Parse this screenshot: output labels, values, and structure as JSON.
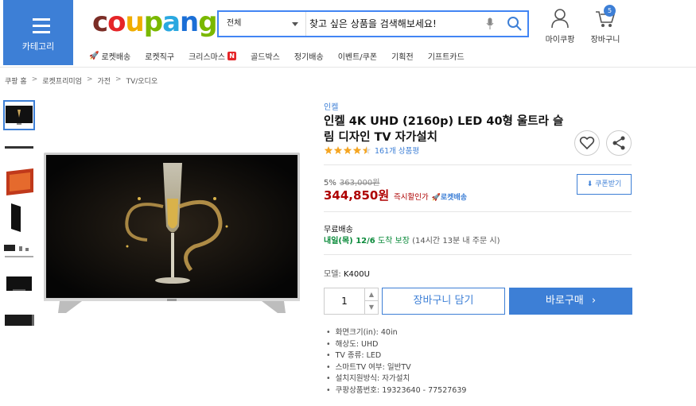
{
  "header": {
    "category_label": "카테고리",
    "logo": {
      "letters": [
        "c",
        "o",
        "u",
        "p",
        "a",
        "n",
        "g"
      ],
      "colors": [
        "#7b2d26",
        "#e52528",
        "#f0ad00",
        "#7ab800",
        "#2aa8e0",
        "#1b6fd6",
        "#7ab800"
      ]
    },
    "search": {
      "scope": "전체",
      "placeholder": "찾고 싶은 상품을 검색해보세요!"
    },
    "mycoupang_label": "마이쿠팡",
    "cart_label": "장바구니",
    "cart_count": "5"
  },
  "nav": {
    "items": [
      {
        "label": "로켓배송"
      },
      {
        "label": "로켓직구"
      },
      {
        "label": "크리스마스",
        "badge": "N"
      },
      {
        "label": "골드박스"
      },
      {
        "label": "정기배송"
      },
      {
        "label": "이벤트/쿠폰"
      },
      {
        "label": "기획전"
      },
      {
        "label": "기프트카드"
      }
    ]
  },
  "breadcrumb": [
    "쿠팡 홈",
    "로켓프리미엄",
    "가전",
    "TV/오디오"
  ],
  "product": {
    "brand": "인켈",
    "title": "인켈 4K UHD (2160p) LED 40형 울트라 슬림 디자인 TV 자가설치",
    "rating": 4.5,
    "review_count": "161개 상품평",
    "discount": "5%",
    "original_price": "363,000원",
    "price": "344,850원",
    "instant_label": "즉시할인가",
    "rocket_label": "로켓배송",
    "coupon_label": "쿠폰받기",
    "shipping": "무료배송",
    "arrival": "내일(목) 12/6",
    "arrival_suffix": "도착 보장",
    "arrival_note": "(14시간 13분 내 주문 시)",
    "model_label": "모델:",
    "model": "K400U",
    "quantity": "1",
    "cart_button": "장바구니 담기",
    "buy_button": "바로구매",
    "specs": [
      "화면크기(in): 40in",
      "해상도: UHD",
      "TV 종류: LED",
      "스마트TV 여부: 일반TV",
      "설치지원방식: 자가설치",
      "쿠팡상품번호: 19323640 - 77527639"
    ]
  },
  "colors": {
    "accent": "#3d7fd6",
    "price": "#ae0000",
    "arrival": "#0a8a3a",
    "star": "#f5a623"
  }
}
